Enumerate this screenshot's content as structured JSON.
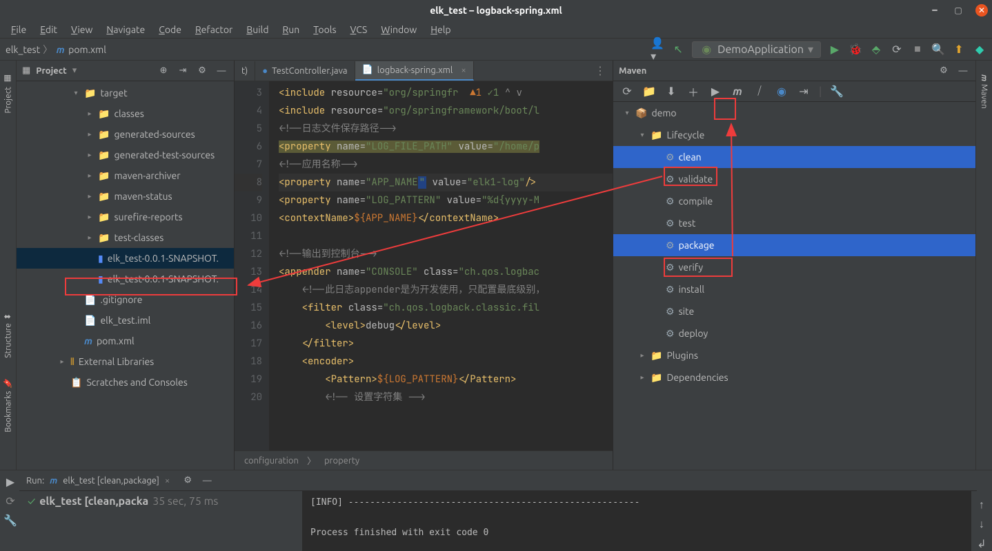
{
  "titlebar": {
    "title": "elk_test – logback-spring.xml"
  },
  "menubar": [
    "File",
    "Edit",
    "View",
    "Navigate",
    "Code",
    "Refactor",
    "Build",
    "Run",
    "Tools",
    "VCS",
    "Window",
    "Help"
  ],
  "breadcrumb": {
    "root": "elk_test",
    "file": "pom.xml"
  },
  "run_config": "DemoApplication",
  "project": {
    "title": "Project",
    "tree": [
      {
        "indent": 1,
        "arrow": "v",
        "type": "folder",
        "name": "target"
      },
      {
        "indent": 2,
        "arrow": ">",
        "type": "folder",
        "name": "classes"
      },
      {
        "indent": 2,
        "arrow": ">",
        "type": "folder",
        "name": "generated-sources"
      },
      {
        "indent": 2,
        "arrow": ">",
        "type": "folder",
        "name": "generated-test-sources"
      },
      {
        "indent": 2,
        "arrow": ">",
        "type": "folder",
        "name": "maven-archiver"
      },
      {
        "indent": 2,
        "arrow": ">",
        "type": "folder",
        "name": "maven-status"
      },
      {
        "indent": 2,
        "arrow": ">",
        "type": "folder",
        "name": "surefire-reports"
      },
      {
        "indent": 2,
        "arrow": ">",
        "type": "folder",
        "name": "test-classes"
      },
      {
        "indent": 2,
        "arrow": "",
        "type": "jar",
        "name": "elk_test-0.0.1-SNAPSHOT.",
        "sel": true
      },
      {
        "indent": 2,
        "arrow": "",
        "type": "jar2",
        "name": "elk_test-0.0.1-SNAPSHOT."
      },
      {
        "indent": 1,
        "arrow": "",
        "type": "git",
        "name": ".gitignore"
      },
      {
        "indent": 1,
        "arrow": "",
        "type": "iml",
        "name": "elk_test.iml"
      },
      {
        "indent": 1,
        "arrow": "",
        "type": "pom",
        "name": "pom.xml"
      },
      {
        "indent": 0,
        "arrow": ">",
        "type": "lib",
        "name": "External Libraries"
      },
      {
        "indent": 0,
        "arrow": "",
        "type": "scratch",
        "name": "Scratches and Consoles"
      }
    ]
  },
  "editor": {
    "tabs": [
      {
        "label": "t)",
        "active": false,
        "type": "plain"
      },
      {
        "label": "TestController.java",
        "active": false,
        "type": "java"
      },
      {
        "label": "logback-spring.xml",
        "active": true,
        "type": "xml"
      }
    ],
    "lines": {
      "start": 3,
      "content": [
        {
          "num": 3,
          "html": "<span class='t-tag'>&lt;include</span> <span class='t-attr'>resource</span>=<span class='t-str'>\"org/springfr</span>  <span style='color:#cc7832'>▲1</span> <span style='color:#6a8759'>✓1</span> <span style='color:#888'>^ v</span>"
        },
        {
          "num": 4,
          "html": "<span class='t-tag'>&lt;include</span> <span class='t-attr'>resource</span>=<span class='t-str'>\"org/springframework/boot/l</span>"
        },
        {
          "num": 5,
          "html": "<span class='t-cmt'>&lt;!--日志文件保存路径--&gt;</span>"
        },
        {
          "num": 6,
          "html": "<span class='hl-y'><span class='t-tag'>&lt;property</span> <span class='t-attr'>name</span>=<span class='t-str'>\"LOG_FILE_PATH\"</span> <span class='t-attr'>value</span>=<span class='t-str'>\"/home/p</span></span>"
        },
        {
          "num": 7,
          "html": "<span class='t-cmt'>&lt;!--应用名称--&gt;</span>"
        },
        {
          "num": 8,
          "hl": true,
          "html": "<span class='t-tag'>&lt;property</span> <span class='t-attr'>name</span>=<span class='t-str'>\"APP_NAME<span class='hl-g'>\"</span></span> <span class='t-attr'>value</span>=<span class='t-str'>\"elk1-log\"</span><span class='t-tag'>/&gt;</span>"
        },
        {
          "num": 9,
          "html": "<span class='t-tag'>&lt;property</span> <span class='t-attr'>name</span>=<span class='t-str'>\"LOG_PATTERN\"</span> <span class='t-attr'>value</span>=<span class='t-str'>\"%d{yyyy-M</span>"
        },
        {
          "num": 10,
          "html": "<span class='t-tag'>&lt;contextName&gt;</span><span class='t-ent'>${APP_NAME}</span><span class='t-tag'>&lt;/contextName&gt;</span>"
        },
        {
          "num": 11,
          "html": ""
        },
        {
          "num": 12,
          "html": "<span class='t-cmt'>&lt;!--输出到控制台--&gt;</span>"
        },
        {
          "num": 13,
          "html": "<span class='t-tag'>&lt;appender</span> <span class='t-attr'>name</span>=<span class='t-str'>\"CONSOLE\"</span> <span class='t-attr'>class</span>=<span class='t-str'>\"ch.qos.logbac</span>"
        },
        {
          "num": 14,
          "html": "    <span class='t-cmt'>&lt;!--此日志appender是为开发使用，只配置最底级别，</span>"
        },
        {
          "num": 15,
          "html": "    <span class='t-tag'>&lt;filter</span> <span class='t-attr'>class</span>=<span class='t-str'>\"ch.qos.logback.classic.fil</span>"
        },
        {
          "num": 16,
          "html": "        <span class='t-tag'>&lt;level&gt;</span>debug<span class='t-tag'>&lt;/level&gt;</span>"
        },
        {
          "num": 17,
          "html": "    <span class='t-tag'>&lt;/filter&gt;</span>"
        },
        {
          "num": 18,
          "html": "    <span class='t-tag'>&lt;encoder&gt;</span>"
        },
        {
          "num": 19,
          "html": "        <span class='t-tag'>&lt;Pattern&gt;</span><span class='t-ent'>${LOG_PATTERN}</span><span class='t-tag'>&lt;/Pattern&gt;</span>"
        },
        {
          "num": 20,
          "html": "        <span class='t-cmt'>&lt;!-- 设置字符集 --&gt;</span>"
        }
      ]
    },
    "breadcrumb": [
      "configuration",
      "property"
    ]
  },
  "maven": {
    "title": "Maven",
    "tree": [
      {
        "indent": 0,
        "arrow": "v",
        "type": "module",
        "name": "demo"
      },
      {
        "indent": 1,
        "arrow": "v",
        "type": "cat",
        "name": "Lifecycle"
      },
      {
        "indent": 2,
        "arrow": "",
        "type": "goal",
        "name": "clean",
        "sel": true
      },
      {
        "indent": 2,
        "arrow": "",
        "type": "goal",
        "name": "validate"
      },
      {
        "indent": 2,
        "arrow": "",
        "type": "goal",
        "name": "compile"
      },
      {
        "indent": 2,
        "arrow": "",
        "type": "goal",
        "name": "test"
      },
      {
        "indent": 2,
        "arrow": "",
        "type": "goal",
        "name": "package",
        "sel": true
      },
      {
        "indent": 2,
        "arrow": "",
        "type": "goal",
        "name": "verify"
      },
      {
        "indent": 2,
        "arrow": "",
        "type": "goal",
        "name": "install"
      },
      {
        "indent": 2,
        "arrow": "",
        "type": "goal",
        "name": "site"
      },
      {
        "indent": 2,
        "arrow": "",
        "type": "goal",
        "name": "deploy"
      },
      {
        "indent": 1,
        "arrow": ">",
        "type": "cat",
        "name": "Plugins"
      },
      {
        "indent": 1,
        "arrow": ">",
        "type": "cat",
        "name": "Dependencies"
      }
    ]
  },
  "run": {
    "label": "Run:",
    "tab": "elk_test [clean,package]",
    "task": "elk_test [clean,packa",
    "time": "35 sec, 75 ms",
    "output": "[INFO] ------------------------------------------------------\n\nProcess finished with exit code 0"
  },
  "left_tabs": [
    "Project",
    "Structure",
    "Bookmarks"
  ],
  "right_tabs": [
    "Maven"
  ]
}
